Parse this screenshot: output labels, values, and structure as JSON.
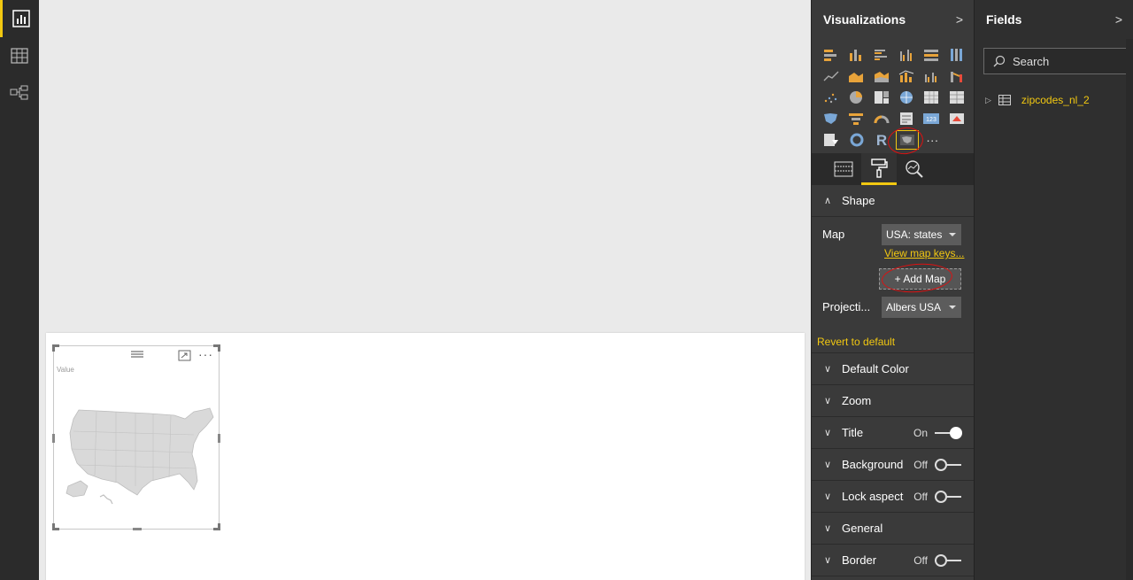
{
  "rail": {
    "items": [
      {
        "name": "report-view",
        "icon": "bar-chart-icon",
        "active": true
      },
      {
        "name": "data-view",
        "icon": "table-grid-icon",
        "active": false
      },
      {
        "name": "relationships-view",
        "icon": "relationships-icon",
        "active": false
      }
    ]
  },
  "canvas": {
    "visual": {
      "title": "Value",
      "map_fill": "#d9d9d9",
      "map_stroke": "#bdbdbd"
    }
  },
  "visualizations": {
    "title": "Visualizations",
    "collapse_glyph": ">",
    "selected_visual": "shape-map",
    "more_glyph": "···",
    "tabs": [
      "fields-tab",
      "format-tab",
      "analytics-tab"
    ],
    "active_tab": "format-tab",
    "shape": {
      "header": "Shape",
      "map_label": "Map",
      "map_value": "USA: states",
      "view_map_keys": "View map keys...",
      "add_map": "+ Add Map",
      "projection_label": "Projecti...",
      "projection_value": "Albers USA"
    },
    "revert": "Revert to default",
    "sections": [
      {
        "label": "Default Color",
        "state": null
      },
      {
        "label": "Zoom",
        "state": null
      },
      {
        "label": "Title",
        "state": "On"
      },
      {
        "label": "Background",
        "state": "Off"
      },
      {
        "label": "Lock aspect",
        "state": "Off"
      },
      {
        "label": "General",
        "state": null
      },
      {
        "label": "Border",
        "state": "Off"
      }
    ]
  },
  "fields": {
    "title": "Fields",
    "collapse_glyph": ">",
    "search_placeholder": "Search",
    "tables": [
      {
        "name": "zipcodes_nl_2"
      }
    ]
  },
  "colors": {
    "accent": "#f2c811",
    "annotation": "#dd1111"
  }
}
